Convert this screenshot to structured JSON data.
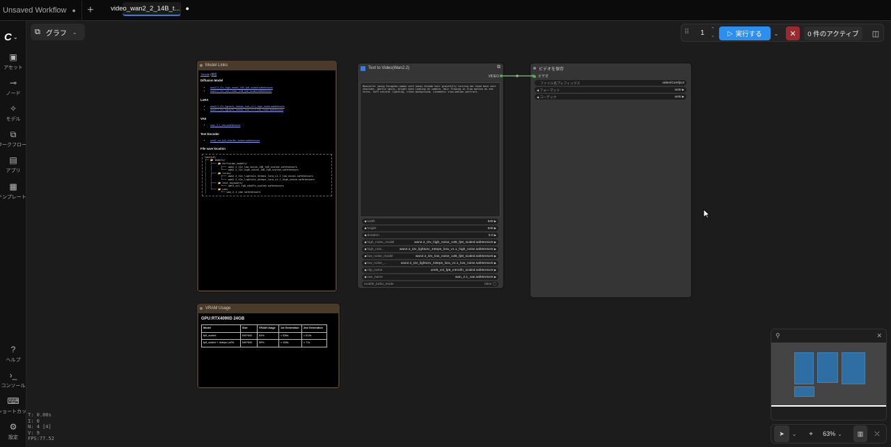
{
  "tabs": [
    {
      "label": "Unsaved Workflow",
      "modified": "●"
    },
    {
      "label": "video_wan2_2_14B_t...",
      "modified": "●"
    }
  ],
  "tab_add": "+",
  "sidebar": {
    "logo": "C",
    "items": [
      {
        "icon": "▣",
        "label": "アセット"
      },
      {
        "icon": "⊸",
        "label": "ノード"
      },
      {
        "icon": "✧",
        "label": "モデル"
      },
      {
        "icon": "⧉",
        "label": "ワークフロー"
      },
      {
        "icon": "▤",
        "label": "アプリ"
      },
      {
        "icon": "▦",
        "label": "テンプレート"
      },
      {
        "icon": "?",
        "label": "ヘルプ"
      },
      {
        "icon": "›_",
        "label": "コンソール"
      },
      {
        "icon": "⌨",
        "label": "ショートカット"
      },
      {
        "icon": "⚙",
        "label": "設定"
      }
    ],
    "stats": [
      "T: 0.00s",
      "I: 0",
      "N: 4 [4]",
      "V: 9",
      "FPS:77.52"
    ]
  },
  "graph_button": {
    "label": "グラフ"
  },
  "toolbar": {
    "queue_count": "1",
    "run_label": "実行する",
    "active_label": "0 件のアクティブ"
  },
  "nodes": {
    "model_links": {
      "title": "Model Links",
      "tutorial_link": "Tutorial",
      "sep": "|",
      "tutorial_link2": "教程",
      "diffusion_heading": "Diffusion Model",
      "diffusion_files": [
        "wan2.2_t2v_high_noise_14B_fp8_scaled.safetensors",
        "wan2.2_t2v_low_noise_14B_fp8_scaled.safetensors"
      ],
      "lora_heading": "LoRA",
      "lora_files": [
        "wan2.2_t2v_lightx2v_4steps_lora_v1.1_high_noise.safetensors",
        "wan2.2_t2v_lightx2v_4steps_lora_v1.1_low_noise.safetensors"
      ],
      "vae_heading": "VAE",
      "vae_files": [
        "wan_2.1_vae.safetensors"
      ],
      "text_encoder_heading": "Text Encoder",
      "text_encoder_files": [
        "umt5_xxl_fp8_e4m3fn_scaled.safetensors"
      ],
      "file_location_heading": "File save location",
      "tree": "ComfyUI/\n├── 📂 models/\n│   ├─── 📂 diffusion_models/\n│   │      ├─── wan2.2_t2v_low_noise_14B_fp8_scaled.safetensors\n│   │      └─── wan2.2_t2v_high_noise_14B_fp8_scaled.safetensors\n│   ├─── 📂 loras/\n│   │      ├─── wan2.2_t2v_lightx2v_4steps_lora_v1.1_low_noise.safetensors\n│   │      └─── wan2.2_t2v_lightx2v_4steps_lora_v1.1_high_noise.safetensors\n│   ├─── 📂 text_encoders/\n│   │      └─── umt5_xxl_fp8_e4m3fn_scaled.safetensors\n│   └─── 📂 vae/\n│          └── wan_2.1_vae.safetensors"
    },
    "vram": {
      "title": "VRAM Usage",
      "heading": "GPU:RTX4090D 24GB",
      "columns": [
        "Model",
        "Size",
        "VRAM Usage",
        "1st Generation",
        "2nd Generation"
      ],
      "rows": [
        [
          "fp8_scaled",
          "640*640",
          "84%",
          "≈ 536s",
          "≈ 513s"
        ],
        [
          "fp8_scaled + 4steps LoRA",
          "640*640",
          "89%",
          "≈ 108s",
          "≈ 71s"
        ]
      ]
    },
    "t2v": {
      "title": "Text to Video(Wan2.2)",
      "output": "VIDEO",
      "prompt": "Beautiful young European woman with honey blonde hair gracefully turning her head back over shoulder, gentle smile, bright eyes looking at camera. Hair flowing in slow motion as she turns. Soft natural lighting, clean background, cinematic slow-motion portrait.",
      "widgets": [
        {
          "name": "width",
          "value": "640"
        },
        {
          "name": "height",
          "value": "640"
        },
        {
          "name": "duration",
          "value": "5.0"
        },
        {
          "name": "high_noise_model",
          "value": "wan2.2_t2v_high_noise_14B_fp8_scaled.safetensors"
        },
        {
          "name": "high_nois...",
          "value": "wan2.2_t2v_lightx2v_4steps_lora_v1.1_high_noise.safetensors"
        },
        {
          "name": "low_noise_model",
          "value": "wan2.2_t2v_low_noise_14B_fp8_scaled.safetensors"
        },
        {
          "name": "low_noise_...",
          "value": "wan2.2_t2v_lightx2v_4steps_lora_v1.1_low_noise.safetensors"
        },
        {
          "name": "clip_name",
          "value": "umt5_xxl_fp8_e4m3fn_scaled.safetensors"
        },
        {
          "name": "vae_name",
          "value": "wan_2.1_vae.safetensors"
        }
      ],
      "toggle": {
        "name": "enable_turbo_mode",
        "value": "false"
      }
    },
    "save_video": {
      "title": "ビデオを保存",
      "input": "ビデオ",
      "widgets": [
        {
          "name": "ファイル名プレフィックス",
          "value": "video/ComfyUI"
        },
        {
          "name": "フォーマット",
          "value": "auto"
        },
        {
          "name": "コーデック",
          "value": "auto"
        }
      ]
    }
  },
  "bottom": {
    "zoom": "63%"
  },
  "colors": {
    "accent": "#2c8ff0",
    "note_header": "#4a3a2a",
    "cancel": "#9b2a30",
    "link_dot": "#4caf50"
  }
}
